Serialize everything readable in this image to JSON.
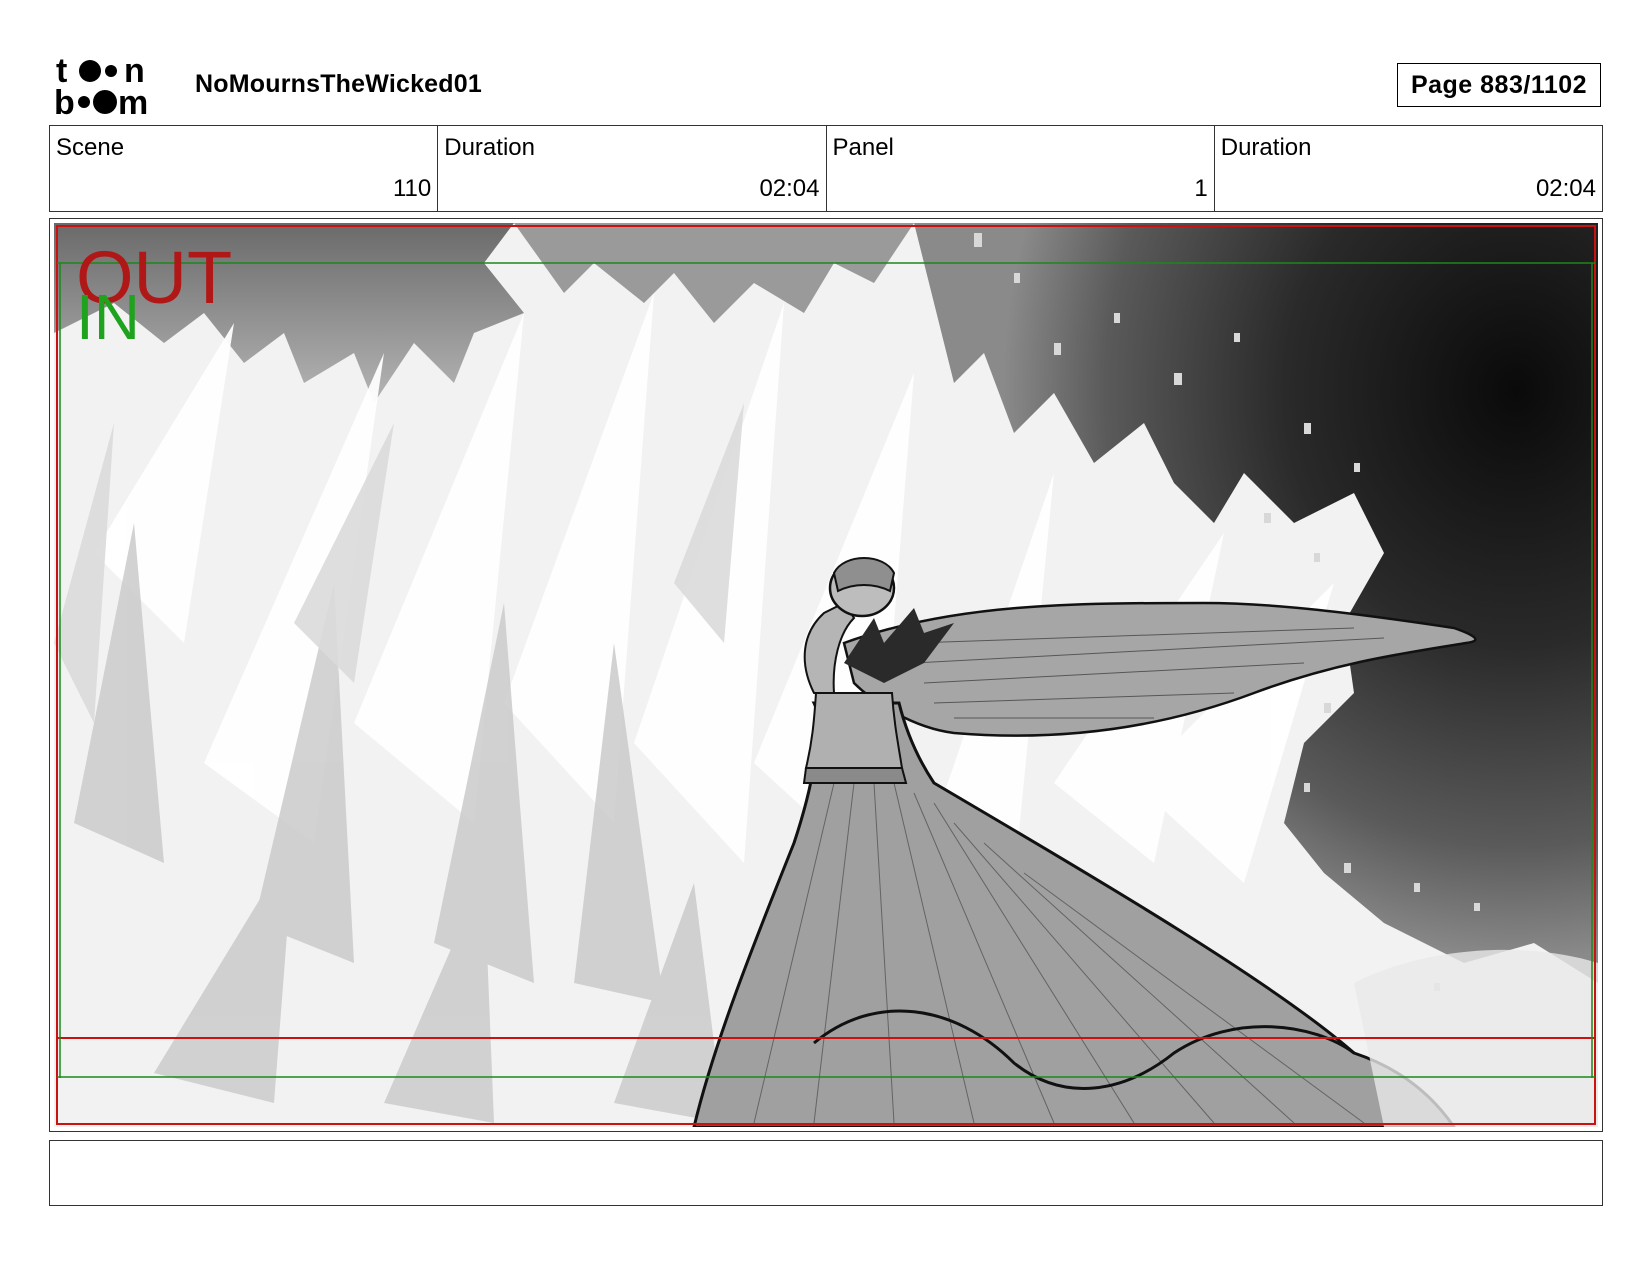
{
  "header": {
    "logo_text": "toon boom",
    "project_title": "NoMournsTheWicked01",
    "page_label": "Page",
    "page_number": "883/1102"
  },
  "info": {
    "scene_label": "Scene",
    "scene_value": "110",
    "scene_duration_label": "Duration",
    "scene_duration_value": "02:04",
    "panel_label": "Panel",
    "panel_value": "1",
    "panel_duration_label": "Duration",
    "panel_duration_value": "02:04"
  },
  "panel": {
    "out_marker": "OUT",
    "in_marker": "IN",
    "out_color": "#b01818",
    "in_color": "#1fa31f"
  },
  "caption": {
    "text": ""
  }
}
